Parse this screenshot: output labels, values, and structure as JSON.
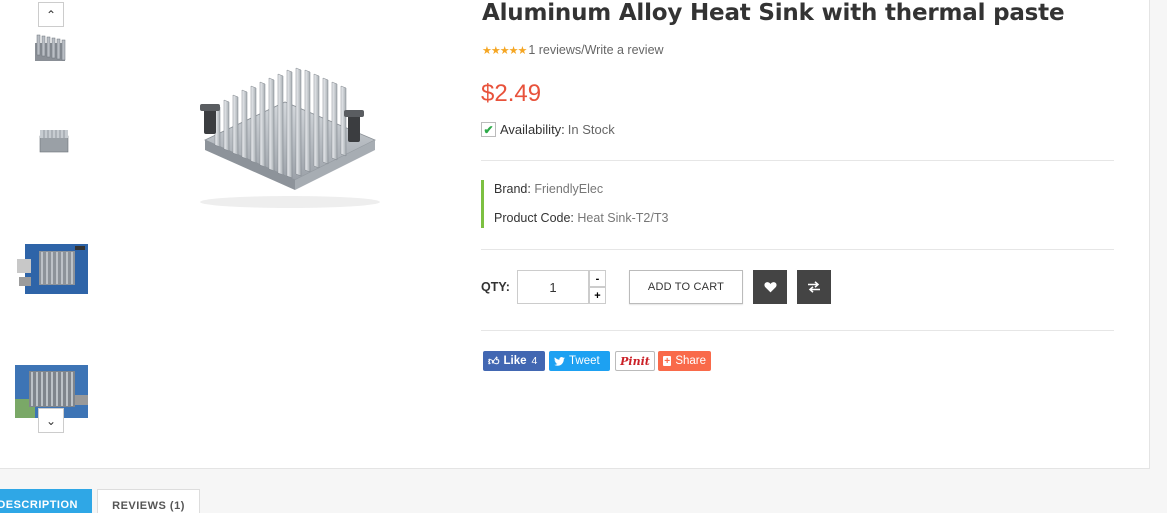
{
  "product": {
    "title": "Aluminum Alloy Heat Sink with thermal paste",
    "stars": "★★★★★",
    "reviews_link": "1 reviews",
    "separator": " / ",
    "write_review_link": "Write a review",
    "price": "$2.49",
    "availability_label": "Availability:",
    "availability_value": "In Stock",
    "brand_label": "Brand:",
    "brand_value": "FriendlyElec",
    "code_label": "Product Code:",
    "code_value": "Heat Sink-T2/T3"
  },
  "purchase": {
    "qty_label": "QTY:",
    "qty_value": "1",
    "minus": "-",
    "plus": "+",
    "add_to_cart": "ADD TO CART"
  },
  "social": {
    "like": "Like",
    "like_count": "4",
    "tweet": "Tweet",
    "pin": "Pinit",
    "share": "Share"
  },
  "tabs": {
    "description": "DESCRIPTION",
    "reviews": "REVIEWS (1)"
  },
  "colors": {
    "price": "#e8523b",
    "accent_green": "#7cc041",
    "tab_active": "#2fa7e6",
    "facebook": "#4267b2",
    "twitter": "#1da1f2",
    "share": "#f96a4a"
  },
  "icons": {
    "wishlist": "heart-icon",
    "compare": "compare-arrows-icon",
    "nav_up": "chevron-up-icon",
    "nav_down": "chevron-down-icon"
  }
}
